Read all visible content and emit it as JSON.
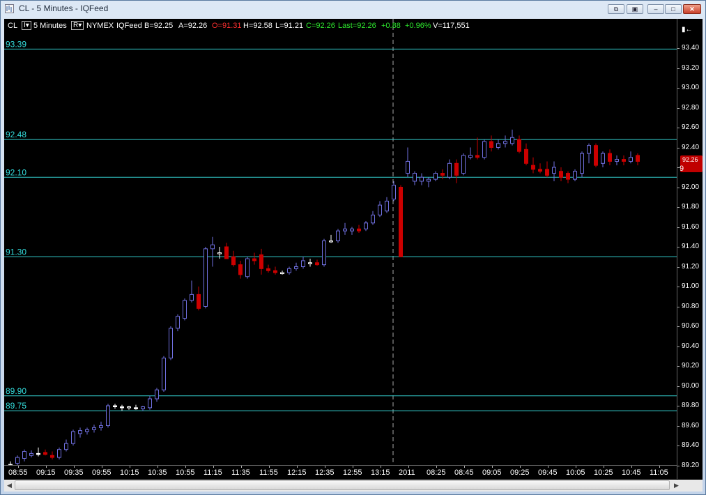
{
  "window": {
    "title": "CL - 5 Minutes - IQFeed",
    "controls": {
      "restore_down": "⧉",
      "tile": "▣",
      "minimize": "‒",
      "maximize": "□",
      "close": "✕"
    }
  },
  "infobar": {
    "symbol": "CL",
    "symbol_menu": "I▾",
    "interval": "5 Minutes",
    "interval_menu": "R▾",
    "exchange": "NYMEX",
    "feed": "IQFeed",
    "bid": "B=92.25",
    "ask": "A=92.26",
    "open": "O=91.31",
    "high": "H=92.58",
    "low": "L=91.21",
    "close": "C=92.26",
    "last": "Last=92.26",
    "change": "+0.88",
    "change_pct": "+0.96%",
    "volume": "V=117,551",
    "colors": {
      "up": "#2ee82e",
      "down": "#ff3030",
      "text": "#ffffff"
    }
  },
  "price_axis": {
    "collapse_button": "▮←",
    "ticks": [
      "93.40",
      "93.20",
      "93.00",
      "92.80",
      "92.60",
      "92.40",
      "92.20",
      "92.00",
      "91.80",
      "91.60",
      "91.40",
      "91.20",
      "91.00",
      "90.80",
      "90.60",
      "90.40",
      "90.20",
      "90.00",
      "89.80",
      "89.60",
      "89.40",
      "89.20"
    ],
    "current_tag": "92.26",
    "current_tag_partial": "9"
  },
  "time_axis": {
    "labels": [
      "08:55",
      "09:15",
      "09:35",
      "09:55",
      "10:15",
      "10:35",
      "10:55",
      "11:15",
      "11:35",
      "11:55",
      "12:15",
      "12:35",
      "12:55",
      "13:15",
      "2011",
      "08:25",
      "08:45",
      "09:05",
      "09:25",
      "09:45",
      "10:05",
      "10:25",
      "10:45",
      "11:05"
    ]
  },
  "chart_data": {
    "type": "candlestick",
    "symbol": "CL",
    "interval": "5 Minutes",
    "ylim": [
      89.2,
      93.45
    ],
    "grid": false,
    "session_break_after_index": 55,
    "colors": {
      "up": "#7070e0",
      "down": "#cc0000",
      "doji": "#ffffff",
      "line": "#33cccc"
    },
    "horizontal_lines": [
      {
        "price": 93.39,
        "label": "93.39"
      },
      {
        "price": 92.48,
        "label": "92.48"
      },
      {
        "price": 92.1,
        "label": "92.10"
      },
      {
        "price": 91.3,
        "label": "91.30"
      },
      {
        "price": 89.9,
        "label": "89.90"
      },
      {
        "price": 89.75,
        "label": "89.75"
      }
    ],
    "ohlc": [
      [
        89.21,
        89.24,
        89.18,
        89.2
      ],
      [
        89.22,
        89.3,
        89.2,
        89.28
      ],
      [
        89.27,
        89.36,
        89.24,
        89.34
      ],
      [
        89.3,
        89.35,
        89.28,
        89.32
      ],
      [
        89.32,
        89.38,
        89.29,
        89.31
      ],
      [
        89.33,
        89.36,
        89.3,
        89.31
      ],
      [
        89.3,
        89.34,
        89.26,
        89.28
      ],
      [
        89.28,
        89.38,
        89.26,
        89.36
      ],
      [
        89.36,
        89.46,
        89.34,
        89.42
      ],
      [
        89.42,
        89.56,
        89.4,
        89.54
      ],
      [
        89.52,
        89.58,
        89.48,
        89.55
      ],
      [
        89.54,
        89.58,
        89.51,
        89.56
      ],
      [
        89.56,
        89.61,
        89.53,
        89.58
      ],
      [
        89.58,
        89.64,
        89.55,
        89.6
      ],
      [
        89.6,
        89.82,
        89.58,
        89.8
      ],
      [
        89.8,
        89.82,
        89.77,
        89.79
      ],
      [
        89.79,
        89.81,
        89.75,
        89.78
      ],
      [
        89.78,
        89.8,
        89.76,
        89.79
      ],
      [
        89.78,
        89.81,
        89.76,
        89.77
      ],
      [
        89.77,
        89.8,
        89.75,
        89.79
      ],
      [
        89.78,
        89.9,
        89.76,
        89.87
      ],
      [
        89.87,
        89.98,
        89.84,
        89.96
      ],
      [
        89.96,
        90.3,
        89.94,
        90.28
      ],
      [
        90.28,
        90.6,
        90.26,
        90.58
      ],
      [
        90.58,
        90.72,
        90.55,
        90.7
      ],
      [
        90.68,
        90.88,
        90.66,
        90.86
      ],
      [
        90.86,
        91.06,
        90.84,
        90.92
      ],
      [
        90.92,
        91.0,
        90.76,
        90.78
      ],
      [
        90.8,
        91.4,
        90.78,
        91.38
      ],
      [
        91.38,
        91.5,
        91.2,
        91.42
      ],
      [
        91.34,
        91.4,
        91.28,
        91.34
      ],
      [
        91.4,
        91.44,
        91.32,
        91.28
      ],
      [
        91.3,
        91.36,
        91.2,
        91.22
      ],
      [
        91.22,
        91.26,
        91.08,
        91.12
      ],
      [
        91.1,
        91.3,
        91.08,
        91.28
      ],
      [
        91.28,
        91.34,
        91.22,
        91.26
      ],
      [
        91.32,
        91.38,
        91.12,
        91.18
      ],
      [
        91.18,
        91.22,
        91.14,
        91.16
      ],
      [
        91.16,
        91.2,
        91.12,
        91.14
      ],
      [
        91.14,
        91.16,
        91.12,
        91.14
      ],
      [
        91.14,
        91.2,
        91.12,
        91.18
      ],
      [
        91.18,
        91.24,
        91.16,
        91.2
      ],
      [
        91.2,
        91.3,
        91.18,
        91.26
      ],
      [
        91.24,
        91.28,
        91.2,
        91.24
      ],
      [
        91.24,
        91.27,
        91.21,
        91.22
      ],
      [
        91.22,
        91.48,
        91.2,
        91.46
      ],
      [
        91.46,
        91.52,
        91.44,
        91.46
      ],
      [
        91.46,
        91.58,
        91.44,
        91.56
      ],
      [
        91.56,
        91.64,
        91.52,
        91.58
      ],
      [
        91.56,
        91.6,
        91.52,
        91.58
      ],
      [
        91.58,
        91.62,
        91.54,
        91.56
      ],
      [
        91.58,
        91.66,
        91.56,
        91.64
      ],
      [
        91.64,
        91.76,
        91.62,
        91.72
      ],
      [
        91.72,
        91.86,
        91.7,
        91.82
      ],
      [
        91.76,
        91.9,
        91.74,
        91.86
      ],
      [
        91.88,
        92.06,
        91.86,
        92.02
      ],
      [
        92.0,
        92.02,
        91.44,
        91.3
      ],
      [
        92.14,
        92.4,
        92.1,
        92.26
      ],
      [
        92.06,
        92.16,
        92.02,
        92.14
      ],
      [
        92.06,
        92.14,
        92.02,
        92.1
      ],
      [
        92.06,
        92.1,
        92.0,
        92.08
      ],
      [
        92.08,
        92.16,
        92.06,
        92.14
      ],
      [
        92.14,
        92.18,
        92.08,
        92.12
      ],
      [
        92.1,
        92.28,
        92.08,
        92.24
      ],
      [
        92.24,
        92.28,
        92.04,
        92.12
      ],
      [
        92.14,
        92.34,
        92.12,
        92.32
      ],
      [
        92.3,
        92.4,
        92.28,
        92.32
      ],
      [
        92.32,
        92.5,
        92.28,
        92.3
      ],
      [
        92.3,
        92.48,
        92.28,
        92.46
      ],
      [
        92.46,
        92.52,
        92.36,
        92.4
      ],
      [
        92.4,
        92.48,
        92.38,
        92.44
      ],
      [
        92.44,
        92.52,
        92.4,
        92.46
      ],
      [
        92.44,
        92.58,
        92.42,
        92.5
      ],
      [
        92.48,
        92.52,
        92.34,
        92.36
      ],
      [
        92.38,
        92.44,
        92.22,
        92.24
      ],
      [
        92.22,
        92.3,
        92.14,
        92.18
      ],
      [
        92.18,
        92.24,
        92.14,
        92.16
      ],
      [
        92.18,
        92.26,
        92.1,
        92.12
      ],
      [
        92.14,
        92.26,
        92.06,
        92.2
      ],
      [
        92.16,
        92.2,
        92.06,
        92.1
      ],
      [
        92.14,
        92.16,
        92.04,
        92.08
      ],
      [
        92.08,
        92.18,
        92.06,
        92.16
      ],
      [
        92.14,
        92.36,
        92.1,
        92.34
      ],
      [
        92.34,
        92.44,
        92.24,
        92.42
      ],
      [
        92.42,
        92.44,
        92.2,
        92.22
      ],
      [
        92.24,
        92.36,
        92.2,
        92.34
      ],
      [
        92.34,
        92.38,
        92.22,
        92.26
      ],
      [
        92.26,
        92.32,
        92.22,
        92.28
      ],
      [
        92.28,
        92.32,
        92.22,
        92.26
      ],
      [
        92.26,
        92.36,
        92.24,
        92.3
      ],
      [
        92.32,
        92.34,
        92.22,
        92.26
      ]
    ]
  }
}
